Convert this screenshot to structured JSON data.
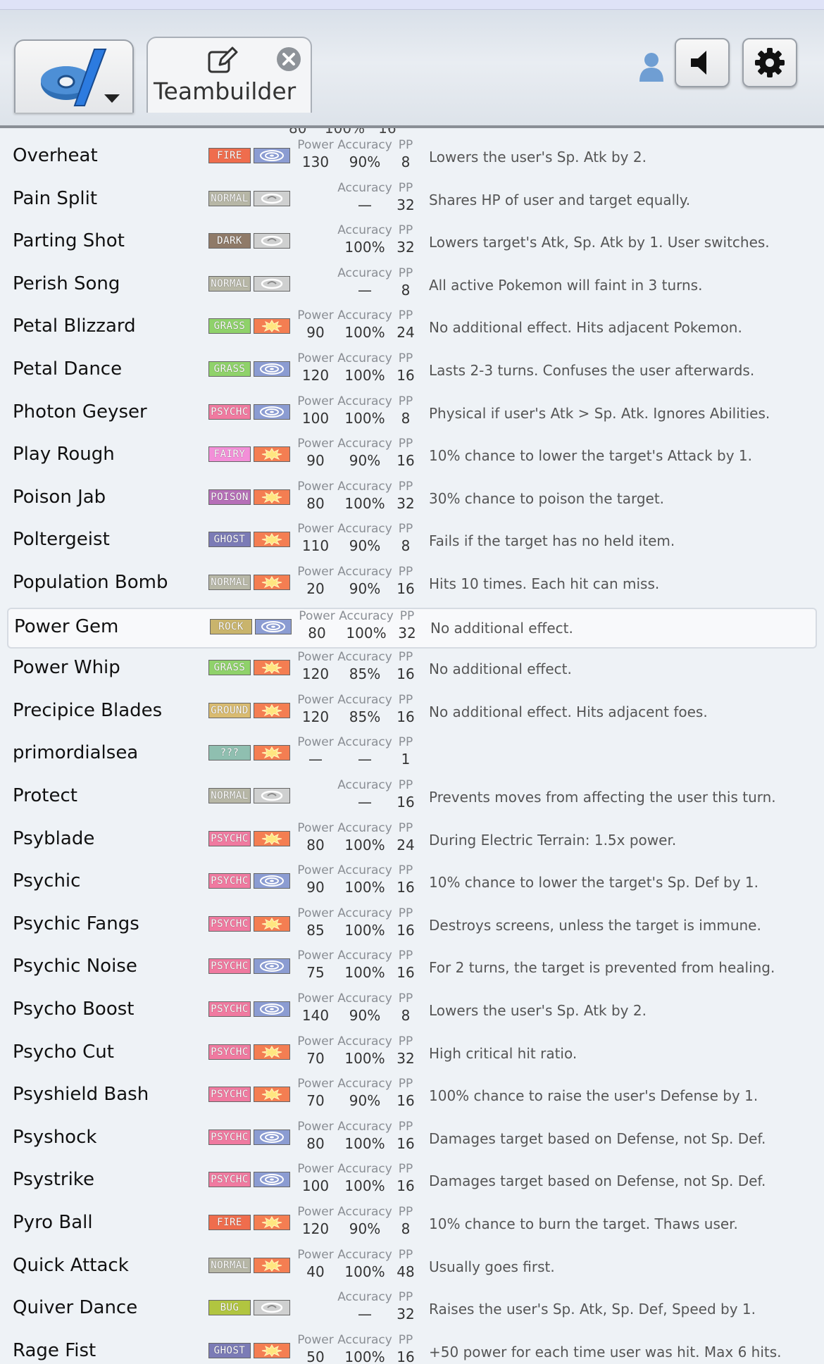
{
  "header": {
    "tab_label": "Teambuilder"
  },
  "colors": {
    "fire": "#ef6d4d",
    "normal": "#b7b7a6",
    "dark": "#8f7a68",
    "grass": "#8fd26a",
    "psychic": "#f07aa0",
    "fairy": "#f38fd8",
    "poison": "#b66fb8",
    "ghost": "#7b7bb6",
    "rock": "#c9b46c",
    "ground": "#d9bb70",
    "unknown": "#8fbfb0",
    "bug": "#b1c540",
    "physical": "#f47e52",
    "special": "#8b9cd2",
    "status": "#cfd0d0"
  },
  "labels": {
    "power": "Power",
    "accuracy": "Accuracy",
    "pp": "PP"
  },
  "moves": [
    {
      "name": "Overheat",
      "type": "FIRE",
      "tc": "fire",
      "cat": "special",
      "power": "130",
      "acc": "90%",
      "pp": "8",
      "desc": "Lowers the user's Sp. Atk by 2."
    },
    {
      "name": "Pain Split",
      "type": "NORMAL",
      "tc": "normal",
      "cat": "status",
      "power": "",
      "acc": "—",
      "pp": "32",
      "desc": "Shares HP of user and target equally."
    },
    {
      "name": "Parting Shot",
      "type": "DARK",
      "tc": "dark",
      "cat": "status",
      "power": "",
      "acc": "100%",
      "pp": "32",
      "desc": "Lowers target's Atk, Sp. Atk by 1. User switches."
    },
    {
      "name": "Perish Song",
      "type": "NORMAL",
      "tc": "normal",
      "cat": "status",
      "power": "",
      "acc": "—",
      "pp": "8",
      "desc": "All active Pokemon will faint in 3 turns."
    },
    {
      "name": "Petal Blizzard",
      "type": "GRASS",
      "tc": "grass",
      "cat": "physical",
      "power": "90",
      "acc": "100%",
      "pp": "24",
      "desc": "No additional effect. Hits adjacent Pokemon."
    },
    {
      "name": "Petal Dance",
      "type": "GRASS",
      "tc": "grass",
      "cat": "special",
      "power": "120",
      "acc": "100%",
      "pp": "16",
      "desc": "Lasts 2-3 turns. Confuses the user afterwards."
    },
    {
      "name": "Photon Geyser",
      "type": "PSYCHC",
      "tc": "psychic",
      "cat": "special",
      "power": "100",
      "acc": "100%",
      "pp": "8",
      "desc": "Physical if user's Atk > Sp. Atk. Ignores Abilities."
    },
    {
      "name": "Play Rough",
      "type": "FAIRY",
      "tc": "fairy",
      "cat": "physical",
      "power": "90",
      "acc": "90%",
      "pp": "16",
      "desc": "10% chance to lower the target's Attack by 1."
    },
    {
      "name": "Poison Jab",
      "type": "POISON",
      "tc": "poison",
      "cat": "physical",
      "power": "80",
      "acc": "100%",
      "pp": "32",
      "desc": "30% chance to poison the target."
    },
    {
      "name": "Poltergeist",
      "type": "GHOST",
      "tc": "ghost",
      "cat": "physical",
      "power": "110",
      "acc": "90%",
      "pp": "8",
      "desc": "Fails if the target has no held item."
    },
    {
      "name": "Population Bomb",
      "type": "NORMAL",
      "tc": "normal",
      "cat": "physical",
      "power": "20",
      "acc": "90%",
      "pp": "16",
      "desc": "Hits 10 times. Each hit can miss."
    },
    {
      "name": "Power Gem",
      "type": "ROCK",
      "tc": "rock",
      "cat": "special",
      "power": "80",
      "acc": "100%",
      "pp": "32",
      "desc": "No additional effect.",
      "hl": true
    },
    {
      "name": "Power Whip",
      "type": "GRASS",
      "tc": "grass",
      "cat": "physical",
      "power": "120",
      "acc": "85%",
      "pp": "16",
      "desc": "No additional effect."
    },
    {
      "name": "Precipice Blades",
      "type": "GROUND",
      "tc": "ground",
      "cat": "physical",
      "power": "120",
      "acc": "85%",
      "pp": "16",
      "desc": "No additional effect. Hits adjacent foes."
    },
    {
      "name": "primordialsea",
      "type": "???",
      "tc": "unknown",
      "cat": "physical",
      "power": "—",
      "acc": "—",
      "pp": "1",
      "desc": ""
    },
    {
      "name": "Protect",
      "type": "NORMAL",
      "tc": "normal",
      "cat": "status",
      "power": "",
      "acc": "—",
      "pp": "16",
      "desc": "Prevents moves from affecting the user this turn."
    },
    {
      "name": "Psyblade",
      "type": "PSYCHC",
      "tc": "psychic",
      "cat": "physical",
      "power": "80",
      "acc": "100%",
      "pp": "24",
      "desc": "During Electric Terrain: 1.5x power."
    },
    {
      "name": "Psychic",
      "type": "PSYCHC",
      "tc": "psychic",
      "cat": "special",
      "power": "90",
      "acc": "100%",
      "pp": "16",
      "desc": "10% chance to lower the target's Sp. Def by 1."
    },
    {
      "name": "Psychic Fangs",
      "type": "PSYCHC",
      "tc": "psychic",
      "cat": "physical",
      "power": "85",
      "acc": "100%",
      "pp": "16",
      "desc": "Destroys screens, unless the target is immune."
    },
    {
      "name": "Psychic Noise",
      "type": "PSYCHC",
      "tc": "psychic",
      "cat": "special",
      "power": "75",
      "acc": "100%",
      "pp": "16",
      "desc": "For 2 turns, the target is prevented from healing."
    },
    {
      "name": "Psycho Boost",
      "type": "PSYCHC",
      "tc": "psychic",
      "cat": "special",
      "power": "140",
      "acc": "90%",
      "pp": "8",
      "desc": "Lowers the user's Sp. Atk by 2."
    },
    {
      "name": "Psycho Cut",
      "type": "PSYCHC",
      "tc": "psychic",
      "cat": "physical",
      "power": "70",
      "acc": "100%",
      "pp": "32",
      "desc": "High critical hit ratio."
    },
    {
      "name": "Psyshield Bash",
      "type": "PSYCHC",
      "tc": "psychic",
      "cat": "physical",
      "power": "70",
      "acc": "90%",
      "pp": "16",
      "desc": "100% chance to raise the user's Defense by 1."
    },
    {
      "name": "Psyshock",
      "type": "PSYCHC",
      "tc": "psychic",
      "cat": "special",
      "power": "80",
      "acc": "100%",
      "pp": "16",
      "desc": "Damages target based on Defense, not Sp. Def."
    },
    {
      "name": "Psystrike",
      "type": "PSYCHC",
      "tc": "psychic",
      "cat": "special",
      "power": "100",
      "acc": "100%",
      "pp": "16",
      "desc": "Damages target based on Defense, not Sp. Def."
    },
    {
      "name": "Pyro Ball",
      "type": "FIRE",
      "tc": "fire",
      "cat": "physical",
      "power": "120",
      "acc": "90%",
      "pp": "8",
      "desc": "10% chance to burn the target. Thaws user."
    },
    {
      "name": "Quick Attack",
      "type": "NORMAL",
      "tc": "normal",
      "cat": "physical",
      "power": "40",
      "acc": "100%",
      "pp": "48",
      "desc": "Usually goes first."
    },
    {
      "name": "Quiver Dance",
      "type": "BUG",
      "tc": "bug",
      "cat": "status",
      "power": "",
      "acc": "—",
      "pp": "32",
      "desc": "Raises the user's Sp. Atk, Sp. Def, Speed by 1."
    },
    {
      "name": "Rage Fist",
      "type": "GHOST",
      "tc": "ghost",
      "cat": "physical",
      "power": "50",
      "acc": "100%",
      "pp": "16",
      "desc": "+50 power for each time user was hit. Max 6 hits."
    }
  ]
}
